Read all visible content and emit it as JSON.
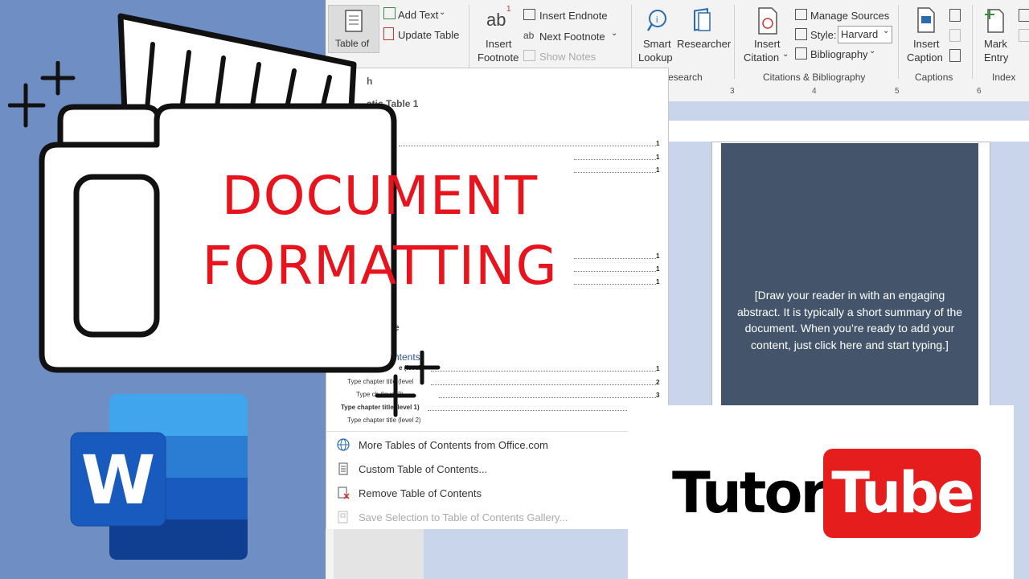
{
  "title": {
    "line1": "DOCUMENT",
    "line2": "FORMATTING"
  },
  "ribbon": {
    "toc_label": "Table of",
    "add_text": "Add Text",
    "update_table": "Update Table",
    "insert_footnote_1": "Insert",
    "insert_footnote_2": "Footnote",
    "insert_endnote": "Insert Endnote",
    "next_footnote": "Next Footnote",
    "show_notes": "Show Notes",
    "smart_lookup_1": "Smart",
    "smart_lookup_2": "Lookup",
    "researcher": "Researcher",
    "research_group": "esearch",
    "insert_citation_1": "Insert",
    "insert_citation_2": "Citation",
    "manage_sources": "Manage Sources",
    "style_label": "Style:",
    "style_value": "Harvard",
    "bibliography": "Bibliography",
    "citations_group": "Citations & Bibliography",
    "insert_caption_1": "Insert",
    "insert_caption_2": "Caption",
    "captions_group": "Captions",
    "mark_entry_1": "Mark",
    "mark_entry_2": "Entry",
    "index_group": "Index",
    "footnote_glyph": "ab",
    "footnote_sup": "1"
  },
  "ruler": {
    "n3": "3",
    "n4": "4",
    "n5": "5",
    "n6": "6"
  },
  "toc_pane": {
    "heading_fragment": "h",
    "auto_table_fragment": "atic Table 1",
    "e_fragment": "e",
    "contents_fragment": "ntents",
    "page_numbers": [
      "1",
      "1",
      "1",
      "1",
      "1",
      "1",
      "1",
      "2",
      "3"
    ],
    "chapter_lines": [
      "e (level",
      "Type chapter title (level",
      "Type ch       (level 3)",
      "Type chapter title (level 1)",
      "Type chapter title (level 2)"
    ]
  },
  "menu": {
    "more_tables": "More Tables of Contents from Office.com",
    "custom_toc": "Custom Table of Contents...",
    "remove_toc": "Remove Table of Contents",
    "save_selection": "Save Selection to Table of Contents Gallery..."
  },
  "document": {
    "abstract": "[Draw your reader in with an engaging abstract. It is typically a short summary of the document. When you’re ready to add your content, just click here and start typing.]"
  },
  "branding": {
    "tutor": "Tutor",
    "tube": "Tube",
    "word_letter": "W"
  },
  "colors": {
    "title_red": "#e8141d",
    "left_blue": "#6e8ec4",
    "cover_slate": "#44546a",
    "tube_red": "#e61d1d",
    "word_blue": "#185abd"
  },
  "icons": [
    "folder-icon",
    "sparkle-icon",
    "word-logo-icon",
    "globe-icon",
    "document-icon",
    "remove-toc-icon",
    "save-icon"
  ]
}
